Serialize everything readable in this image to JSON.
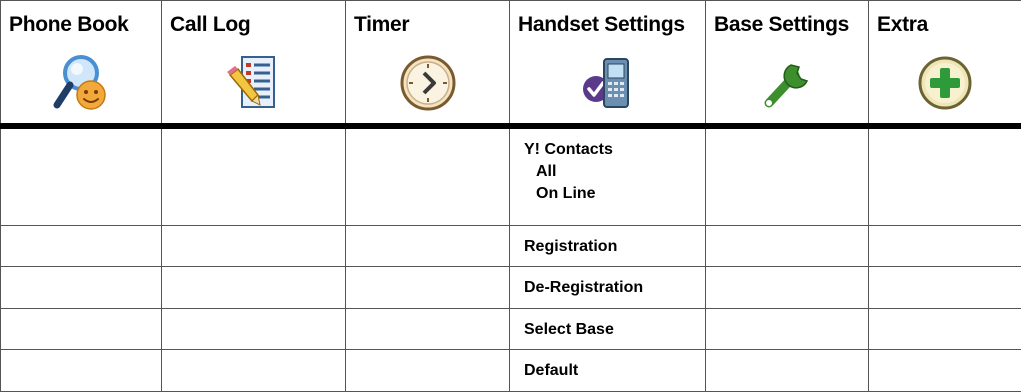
{
  "columns": [
    {
      "label": "Phone Book",
      "icon": "phonebook-search-icon"
    },
    {
      "label": "Call Log",
      "icon": "call-log-notepad-icon"
    },
    {
      "label": "Timer",
      "icon": "clock-timer-icon"
    },
    {
      "label": "Handset Settings",
      "icon": "handset-settings-icon"
    },
    {
      "label": "Base Settings",
      "icon": "wrench-icon"
    },
    {
      "label": "Extra",
      "icon": "plus-circle-icon"
    }
  ],
  "handset_settings": {
    "y_contacts": "Y! Contacts",
    "y_contacts_all": "All",
    "y_contacts_online": "On Line",
    "registration": "Registration",
    "deregistration": "De-Registration",
    "select_base": "Select Base",
    "default": "Default"
  },
  "colors": {
    "border": "#555555",
    "header_rule": "#000000",
    "magnifier_blue": "#4a8fd0",
    "smiley": "#f2a93b",
    "wrench_green": "#3d8f2e",
    "plus_green": "#2e9a3a",
    "phone_purple": "#5b3a8c"
  }
}
